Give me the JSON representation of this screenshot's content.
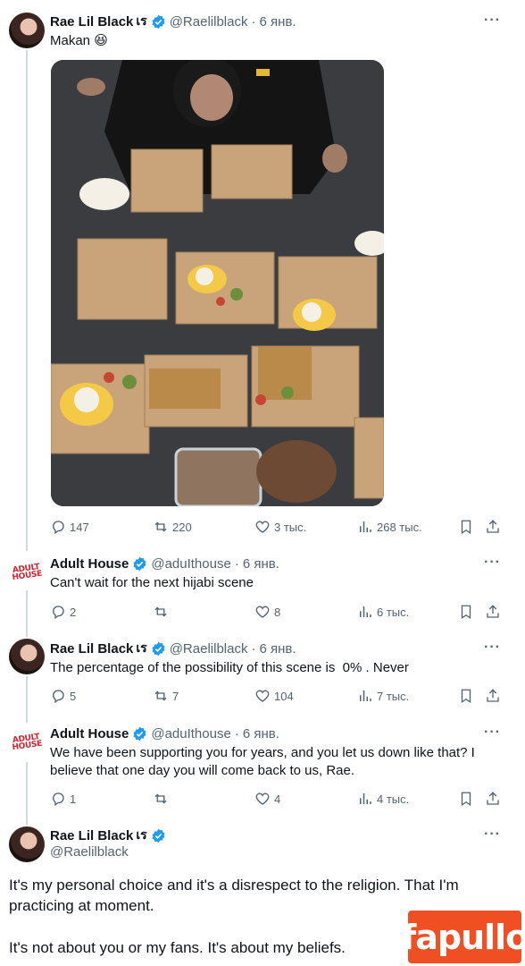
{
  "colors": {
    "accent": "#1d9bf0",
    "muted": "#536471",
    "text": "#0f1419",
    "watermark": "#f04e23"
  },
  "tweets": [
    {
      "name": "Rae Lil Black",
      "glyph": "เร",
      "handle": "@Raelilblack",
      "sep": "·",
      "date": "6 янв.",
      "text": "Makan 😆",
      "has_media": true,
      "stats": {
        "replies": "147",
        "retweets": "220",
        "likes": "3 тыс.",
        "views": "268 тыс."
      }
    },
    {
      "name": "Adult House",
      "handle": "@aduIthouse",
      "sep": "·",
      "date": "6 янв.",
      "text": "Can't wait for the next hijabi scene",
      "stats": {
        "replies": "2",
        "retweets": "",
        "likes": "8",
        "views": "6 тыс."
      }
    },
    {
      "name": "Rae Lil Black",
      "glyph": "เร",
      "handle": "@Raelilblack",
      "sep": "·",
      "date": "6 янв.",
      "text": "The percentage of the possibility of this scene is  0% . Never",
      "stats": {
        "replies": "5",
        "retweets": "7",
        "likes": "104",
        "views": "7 тыс."
      }
    },
    {
      "name": "Adult House",
      "handle": "@aduIthouse",
      "sep": "·",
      "date": "6 янв.",
      "text": "We have been supporting you for years, and you let us down like that? I believe that one day you will come back to us, Rae.",
      "stats": {
        "replies": "1",
        "retweets": "",
        "likes": "4",
        "views": "4 тыс."
      }
    }
  ],
  "main_tweet": {
    "name": "Rae Lil Black",
    "glyph": "เร",
    "handle": "@Raelilblack",
    "paragraph1": "It's my personal choice and it's a disrespect to the religion. That I'm practicing at moment.",
    "paragraph2": "It's not about you or my fans. It's about my beliefs."
  },
  "logo_text": {
    "house_line1": "ADULT",
    "house_line2": "HOUSE"
  },
  "watermark": "fapullo",
  "more_label": "···"
}
